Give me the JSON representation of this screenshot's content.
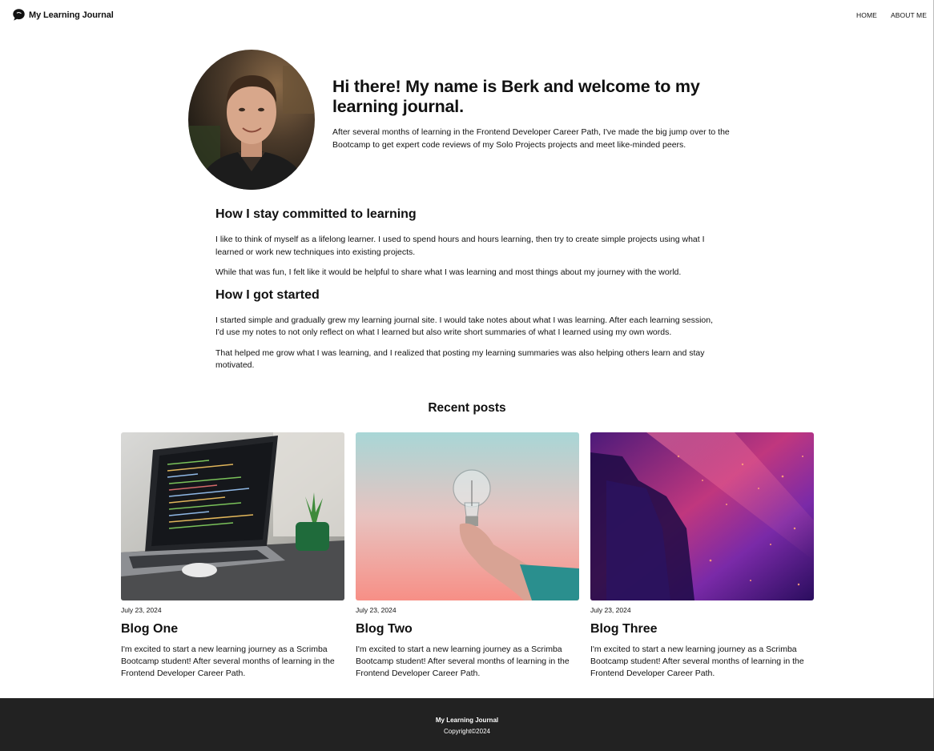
{
  "header": {
    "brand": "My Learning Journal",
    "brand_icon": "chat-bubble-icon",
    "nav": {
      "home": "HOME",
      "about": "ABOUT ME"
    }
  },
  "hero": {
    "title": "Hi there! My name is Berk and welcome to my learning journal.",
    "text": "After several months of learning in the Frontend Developer Career Path, I've made the big jump over to the Bootcamp to get expert code reviews of my Solo Projects projects and meet like-minded peers."
  },
  "article": {
    "section1_title": "How I stay committed to learning",
    "section1_p1": "I like to think of myself as a lifelong learner. I used to spend hours and hours learning, then try to create simple projects using what I learned or work new techniques into existing projects.",
    "section1_p2": "While that was fun, I felt like it would be helpful to share what I was learning and most things about my journey with the world.",
    "section2_title": "How I got started",
    "section2_p1": "I started simple and gradually grew my learning journal site. I would take notes about what I was learning. After each learning session, I'd use my notes to not only reflect on what I learned but also write short summaries of what I learned using my own words.",
    "section2_p2": "That helped me grow what I was learning, and I realized that posting my learning summaries was also helping others learn and stay motivated."
  },
  "recent": {
    "title": "Recent posts",
    "posts": [
      {
        "date": "July 23, 2024",
        "title": "Blog One",
        "text": "I'm excited to start a new learning journey as a Scrimba Bootcamp student! After several months of learning in the Frontend Developer Career Path."
      },
      {
        "date": "July 23, 2024",
        "title": "Blog Two",
        "text": "I'm excited to start a new learning journey as a Scrimba Bootcamp student! After several months of learning in the Frontend Developer Career Path."
      },
      {
        "date": "July 23, 2024",
        "title": "Blog Three",
        "text": "I'm excited to start a new learning journey as a Scrimba Bootcamp student! After several months of learning in the Frontend Developer Career Path."
      }
    ]
  },
  "footer": {
    "title": "My Learning Journal",
    "copyright": "Copyright©2024"
  },
  "colors": {
    "footer_bg": "#222222",
    "text": "#111111"
  }
}
